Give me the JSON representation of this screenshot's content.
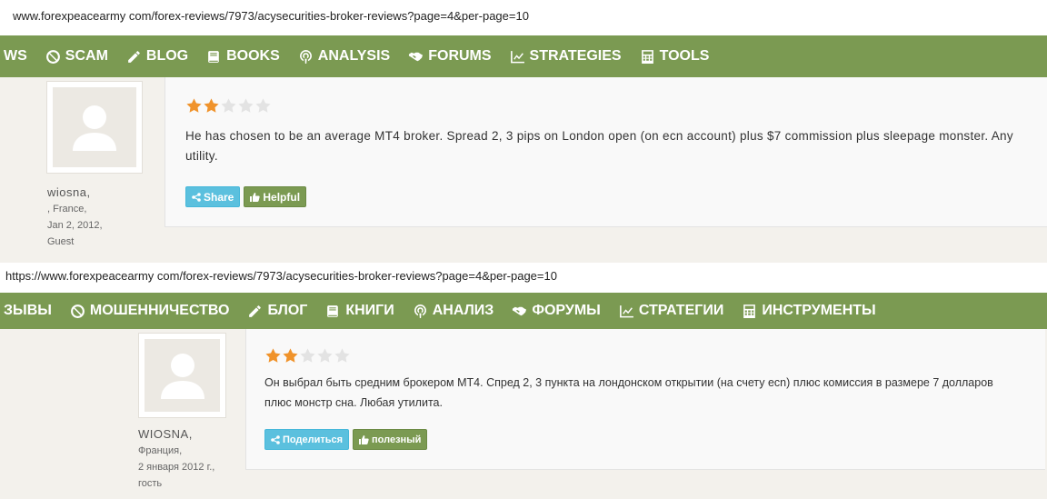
{
  "top": {
    "url": "www.forexpeacearmy com/forex-reviews/7973/acysecurities-broker-reviews?page=4&per-page=10",
    "nav": [
      {
        "label": "WS",
        "icon": ""
      },
      {
        "label": "SCAM",
        "icon": "ban-icon"
      },
      {
        "label": "BLOG",
        "icon": "pencil-icon"
      },
      {
        "label": "BOOKS",
        "icon": "book-icon"
      },
      {
        "label": "ANALYSIS",
        "icon": "podcast-icon"
      },
      {
        "label": "FORUMS",
        "icon": "handshake-icon"
      },
      {
        "label": "STRATEGIES",
        "icon": "line-chart-icon"
      },
      {
        "label": "TOOLS",
        "icon": "calculator-icon"
      }
    ],
    "review": {
      "rating": 2,
      "max_rating": 5,
      "text": "He has chosen to be an average MT4 broker. Spread 2, 3 pips on London open (on ecn account) plus $7 commission plus sleepage monster. Any utility.",
      "share_label": "Share",
      "helpful_label": "Helpful"
    },
    "author": {
      "name": "wiosna,",
      "location": ", France,",
      "date": "Jan 2, 2012,",
      "role": "Guest"
    }
  },
  "bottom": {
    "url": "https://www.forexpeacearmy com/forex-reviews/7973/acysecurities-broker-reviews?page=4&per-page=10",
    "nav": [
      {
        "label": "ЗЫВЫ",
        "icon": ""
      },
      {
        "label": "МОШЕННИЧЕСТВО",
        "icon": "ban-icon"
      },
      {
        "label": "БЛОГ",
        "icon": "pencil-icon"
      },
      {
        "label": "КНИГИ",
        "icon": "book-icon"
      },
      {
        "label": "АНАЛИЗ",
        "icon": "podcast-icon"
      },
      {
        "label": "ФОРУМЫ",
        "icon": "handshake-icon"
      },
      {
        "label": "СТРАТЕГИИ",
        "icon": "line-chart-icon"
      },
      {
        "label": "ИНСТРУМЕНТЫ",
        "icon": "calculator-icon"
      }
    ],
    "review": {
      "rating": 2,
      "max_rating": 5,
      "text": "Он выбрал быть средним брокером МТ4. Спред 2, 3 пункта на лондонском открытии (на счету ecn) плюс комиссия в размере 7 долларов плюс монстр сна. Любая утилита.",
      "share_label": "Поделиться",
      "helpful_label": "полезный"
    },
    "author": {
      "name": "WIOSNA,",
      "location": "Франция,",
      "date": "2 января 2012 г.,",
      "role": "гость"
    }
  },
  "colors": {
    "nav_green": "#7b9a52",
    "star_filled": "#f0932b",
    "star_empty": "#e3e3e3",
    "share_blue": "#5bc0de"
  }
}
